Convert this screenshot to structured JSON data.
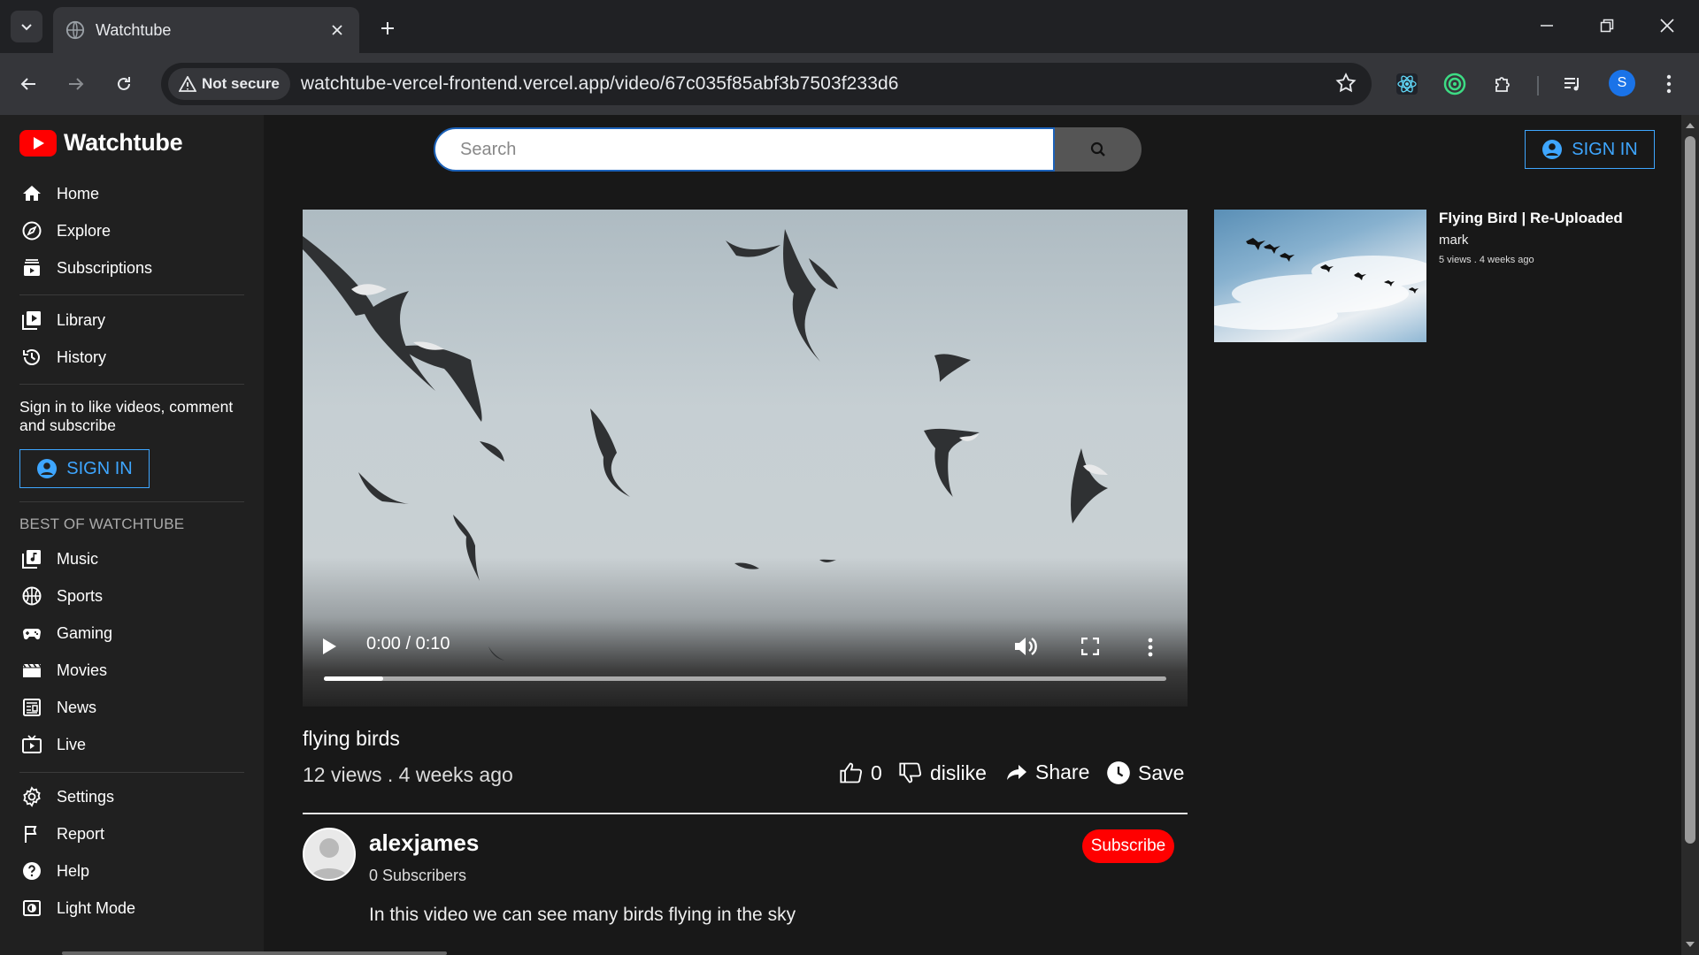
{
  "browser": {
    "tab_title": "Watchtube",
    "security_label": "Not secure",
    "url": "watchtube-vercel-frontend.vercel.app/video/67c035f85abf3b7503f233d6",
    "profile_initial": "S"
  },
  "app": {
    "name": "Watchtube",
    "brand_color": "#ff0000",
    "accent_color": "#3ea6ff"
  },
  "sidebar": {
    "items_top": [
      {
        "label": "Home",
        "icon": "home-icon"
      },
      {
        "label": "Explore",
        "icon": "explore-icon"
      },
      {
        "label": "Subscriptions",
        "icon": "subscriptions-icon"
      }
    ],
    "items_library": [
      {
        "label": "Library",
        "icon": "library-icon"
      },
      {
        "label": "History",
        "icon": "history-icon"
      }
    ],
    "signin_prompt": "Sign in to like videos, comment and subscribe",
    "signin_label": "SIGN IN",
    "section_title": "BEST OF WATCHTUBE",
    "items_best": [
      {
        "label": "Music",
        "icon": "music-icon"
      },
      {
        "label": "Sports",
        "icon": "sports-icon"
      },
      {
        "label": "Gaming",
        "icon": "gaming-icon"
      },
      {
        "label": "Movies",
        "icon": "movies-icon"
      },
      {
        "label": "News",
        "icon": "news-icon"
      },
      {
        "label": "Live",
        "icon": "live-icon"
      }
    ],
    "items_bottom": [
      {
        "label": "Settings",
        "icon": "settings-icon"
      },
      {
        "label": "Report",
        "icon": "flag-icon"
      },
      {
        "label": "Help",
        "icon": "help-icon"
      },
      {
        "label": "Light Mode",
        "icon": "light-mode-icon"
      }
    ]
  },
  "header": {
    "search_placeholder": "Search",
    "signin_label": "SIGN IN"
  },
  "video": {
    "time": "0:00 / 0:10",
    "progress": 0.07,
    "title": "flying birds",
    "meta": "12 views . 4 weeks ago",
    "likes": "0",
    "dislike_label": "dislike",
    "share_label": "Share",
    "save_label": "Save",
    "channel": "alexjames",
    "subscribers": "0 Subscribers",
    "subscribe_label": "Subscribe",
    "description": "In this video we can see many birds flying in the sky"
  },
  "recommended": [
    {
      "title": "Flying Bird | Re-Uploaded",
      "channel": "mark",
      "meta": "5 views . 4 weeks ago"
    }
  ]
}
